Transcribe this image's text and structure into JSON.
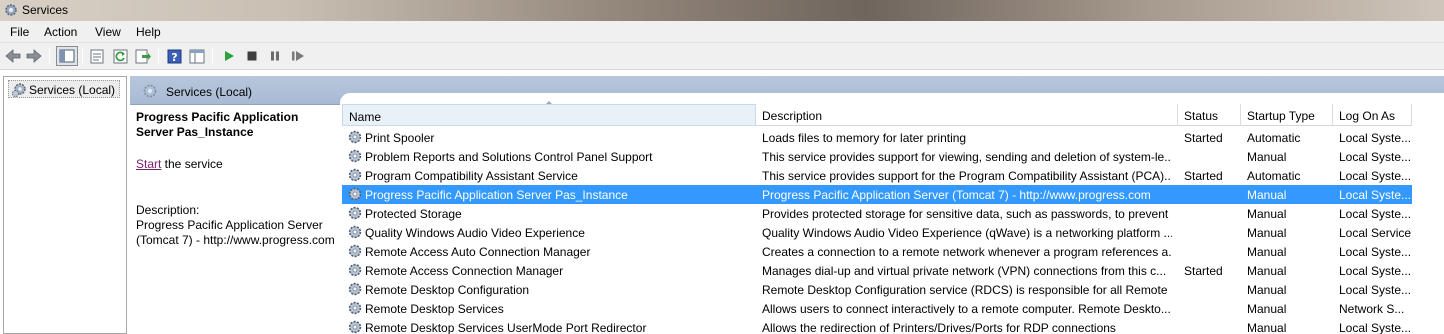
{
  "window": {
    "title": "Services",
    "icon": "gears-icon"
  },
  "menu": {
    "items": [
      "File",
      "Action",
      "View",
      "Help"
    ]
  },
  "toolbar": {
    "buttons": [
      "back-icon",
      "forward-icon",
      "show-hide-console-tree-icon",
      "properties-icon",
      "refresh-icon",
      "export-list-icon",
      "help-icon",
      "extended-view-icon",
      "start-service-icon",
      "stop-service-icon",
      "pause-service-icon",
      "restart-service-icon"
    ]
  },
  "tree": {
    "root_label": "Services (Local)"
  },
  "main": {
    "header": "Services (Local)",
    "detail": {
      "service_name": "Progress Pacific Application Server Pas_Instance",
      "start_link": "Start",
      "start_suffix": " the service",
      "description_label": "Description:",
      "description": "Progress Pacific Application Server (Tomcat 7) - http://www.progress.com"
    }
  },
  "list": {
    "columns": [
      "Name",
      "Description",
      "Status",
      "Startup Type",
      "Log On As"
    ],
    "sorted_column": "Name",
    "selected_row": 3,
    "rows": [
      {
        "name": "Print Spooler",
        "description": "Loads files to memory for later printing",
        "status": "Started",
        "startup": "Automatic",
        "logon": "Local Syste..."
      },
      {
        "name": "Problem Reports and Solutions Control Panel Support",
        "description": "This service provides support for viewing, sending and deletion of system-le...",
        "status": "",
        "startup": "Manual",
        "logon": "Local Syste..."
      },
      {
        "name": "Program Compatibility Assistant Service",
        "description": "This service provides support for the Program Compatibility Assistant (PCA)...",
        "status": "Started",
        "startup": "Automatic",
        "logon": "Local Syste..."
      },
      {
        "name": "Progress Pacific Application Server Pas_Instance",
        "description": "Progress Pacific Application Server (Tomcat 7) - http://www.progress.com",
        "status": "",
        "startup": "Manual",
        "logon": "Local Syste..."
      },
      {
        "name": "Protected Storage",
        "description": "Provides protected storage for sensitive data, such as passwords, to prevent ...",
        "status": "",
        "startup": "Manual",
        "logon": "Local Syste..."
      },
      {
        "name": "Quality Windows Audio Video Experience",
        "description": "Quality Windows Audio Video Experience (qWave) is a networking platform ...",
        "status": "",
        "startup": "Manual",
        "logon": "Local Service"
      },
      {
        "name": "Remote Access Auto Connection Manager",
        "description": "Creates a connection to a remote network whenever a program references a...",
        "status": "",
        "startup": "Manual",
        "logon": "Local Syste..."
      },
      {
        "name": "Remote Access Connection Manager",
        "description": "Manages dial-up and virtual private network (VPN) connections from this c...",
        "status": "Started",
        "startup": "Manual",
        "logon": "Local Syste..."
      },
      {
        "name": "Remote Desktop Configuration",
        "description": "Remote Desktop Configuration service (RDCS) is responsible for all Remote ...",
        "status": "",
        "startup": "Manual",
        "logon": "Local Syste..."
      },
      {
        "name": "Remote Desktop Services",
        "description": "Allows users to connect interactively to a remote computer. Remote Deskto...",
        "status": "",
        "startup": "Manual",
        "logon": "Network S..."
      },
      {
        "name": "Remote Desktop Services UserMode Port Redirector",
        "description": "Allows the redirection of Printers/Drives/Ports for RDP connections",
        "status": "",
        "startup": "Manual",
        "logon": "Local Syste..."
      }
    ]
  }
}
